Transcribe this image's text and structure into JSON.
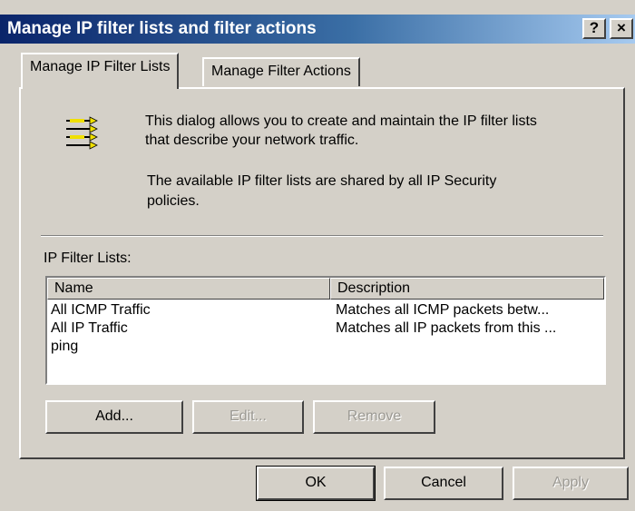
{
  "window": {
    "title": "Manage IP filter lists and filter actions",
    "help_button": "?",
    "close_button": "×"
  },
  "tabs": [
    {
      "label": "Manage IP Filter Lists",
      "active": true
    },
    {
      "label": "Manage Filter Actions",
      "active": false
    }
  ],
  "info": {
    "icon": "filter-list-icon",
    "line1": "This dialog allows you to create and maintain the IP filter lists",
    "line2": "that describe your network traffic.",
    "line3": "The available IP filter lists are shared by all IP Security",
    "line4": "policies."
  },
  "filter_list": {
    "label": "IP Filter Lists:",
    "columns": [
      "Name",
      "Description"
    ],
    "rows": [
      {
        "name": "All ICMP Traffic",
        "description": "Matches all ICMP packets betw..."
      },
      {
        "name": "All IP Traffic",
        "description": "Matches all IP packets from this ..."
      },
      {
        "name": "ping",
        "description": ""
      }
    ]
  },
  "list_buttons": {
    "add": "Add...",
    "edit": "Edit...",
    "remove": "Remove"
  },
  "dialog_buttons": {
    "ok": "OK",
    "cancel": "Cancel",
    "apply": "Apply"
  },
  "colors": {
    "titlebar_start": "#0a246a",
    "titlebar_end": "#a6caf0",
    "face": "#d4d0c8"
  }
}
